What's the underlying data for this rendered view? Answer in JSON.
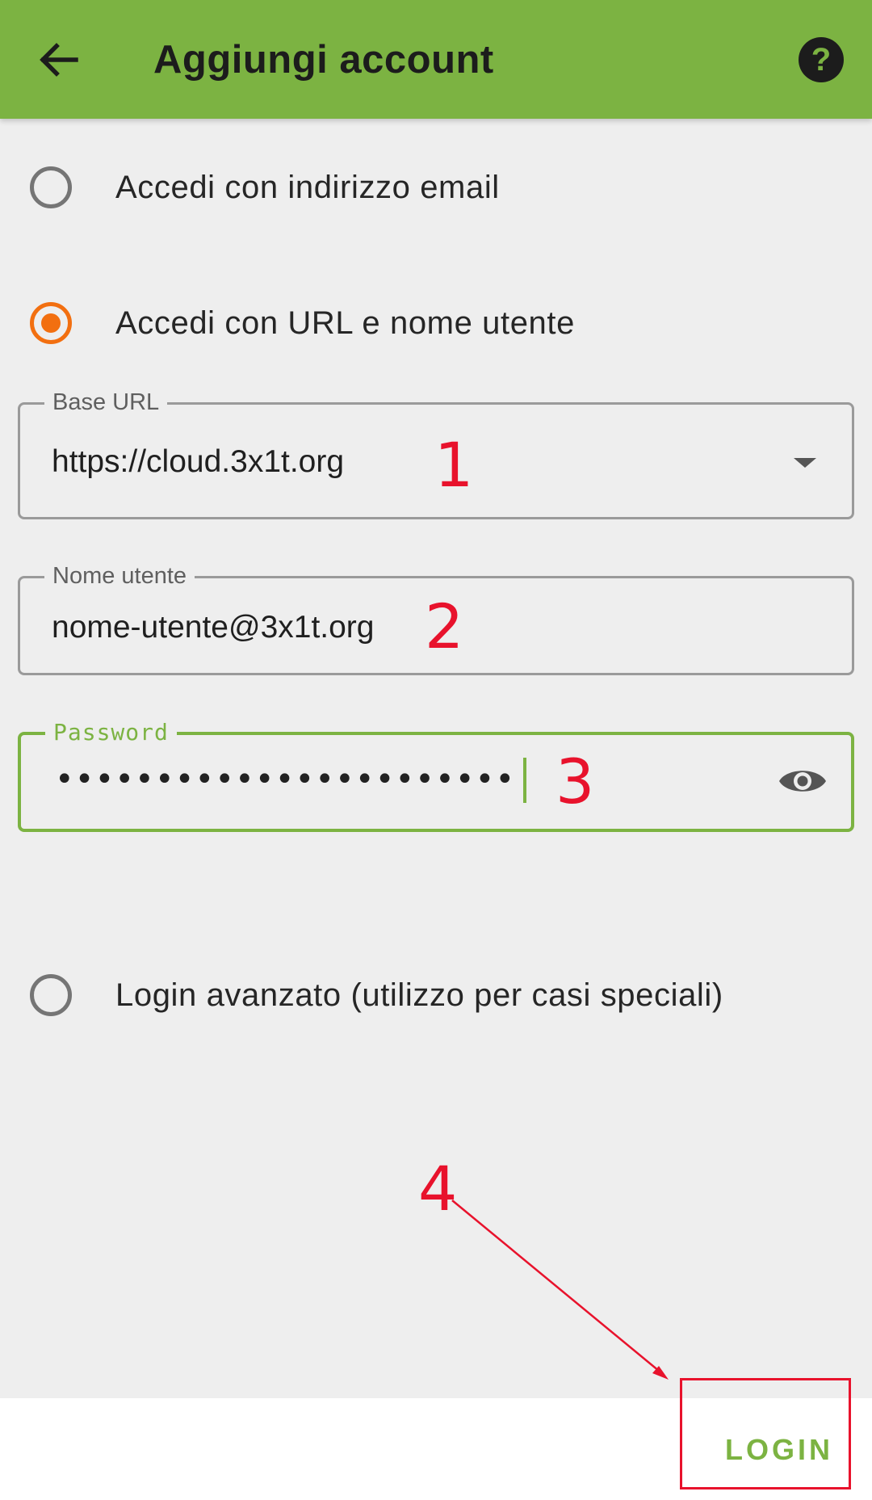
{
  "appbar": {
    "title": "Aggiungi account",
    "back_icon": "arrow-back-icon",
    "help_icon": "help-circle-icon",
    "background": "#7cb342"
  },
  "login_options": {
    "email_option": {
      "label": "Accedi con indirizzo email",
      "selected": false
    },
    "url_option": {
      "label": "Accedi con URL e nome utente",
      "selected": true
    },
    "advanced_option": {
      "label": "Login avanzato (utilizzo per casi speciali)",
      "selected": false
    }
  },
  "fields": {
    "base_url": {
      "label": "Base URL",
      "value": "https://cloud.3x1t.org"
    },
    "username": {
      "label": "Nome utente",
      "value": "nome-utente@3x1t.org"
    },
    "password": {
      "label": "Password",
      "masked_value": "•••••••••••••••••••••••",
      "toggle_icon": "eye-icon"
    }
  },
  "footer": {
    "login_label": "LOGIN"
  },
  "annotations": {
    "step1": "1",
    "step2": "2",
    "step3": "3",
    "step4": "4",
    "color": "#e8122c"
  },
  "colors": {
    "accent": "#7cb342",
    "radio_selected": "#f26f10",
    "annotation": "#e8122c"
  }
}
